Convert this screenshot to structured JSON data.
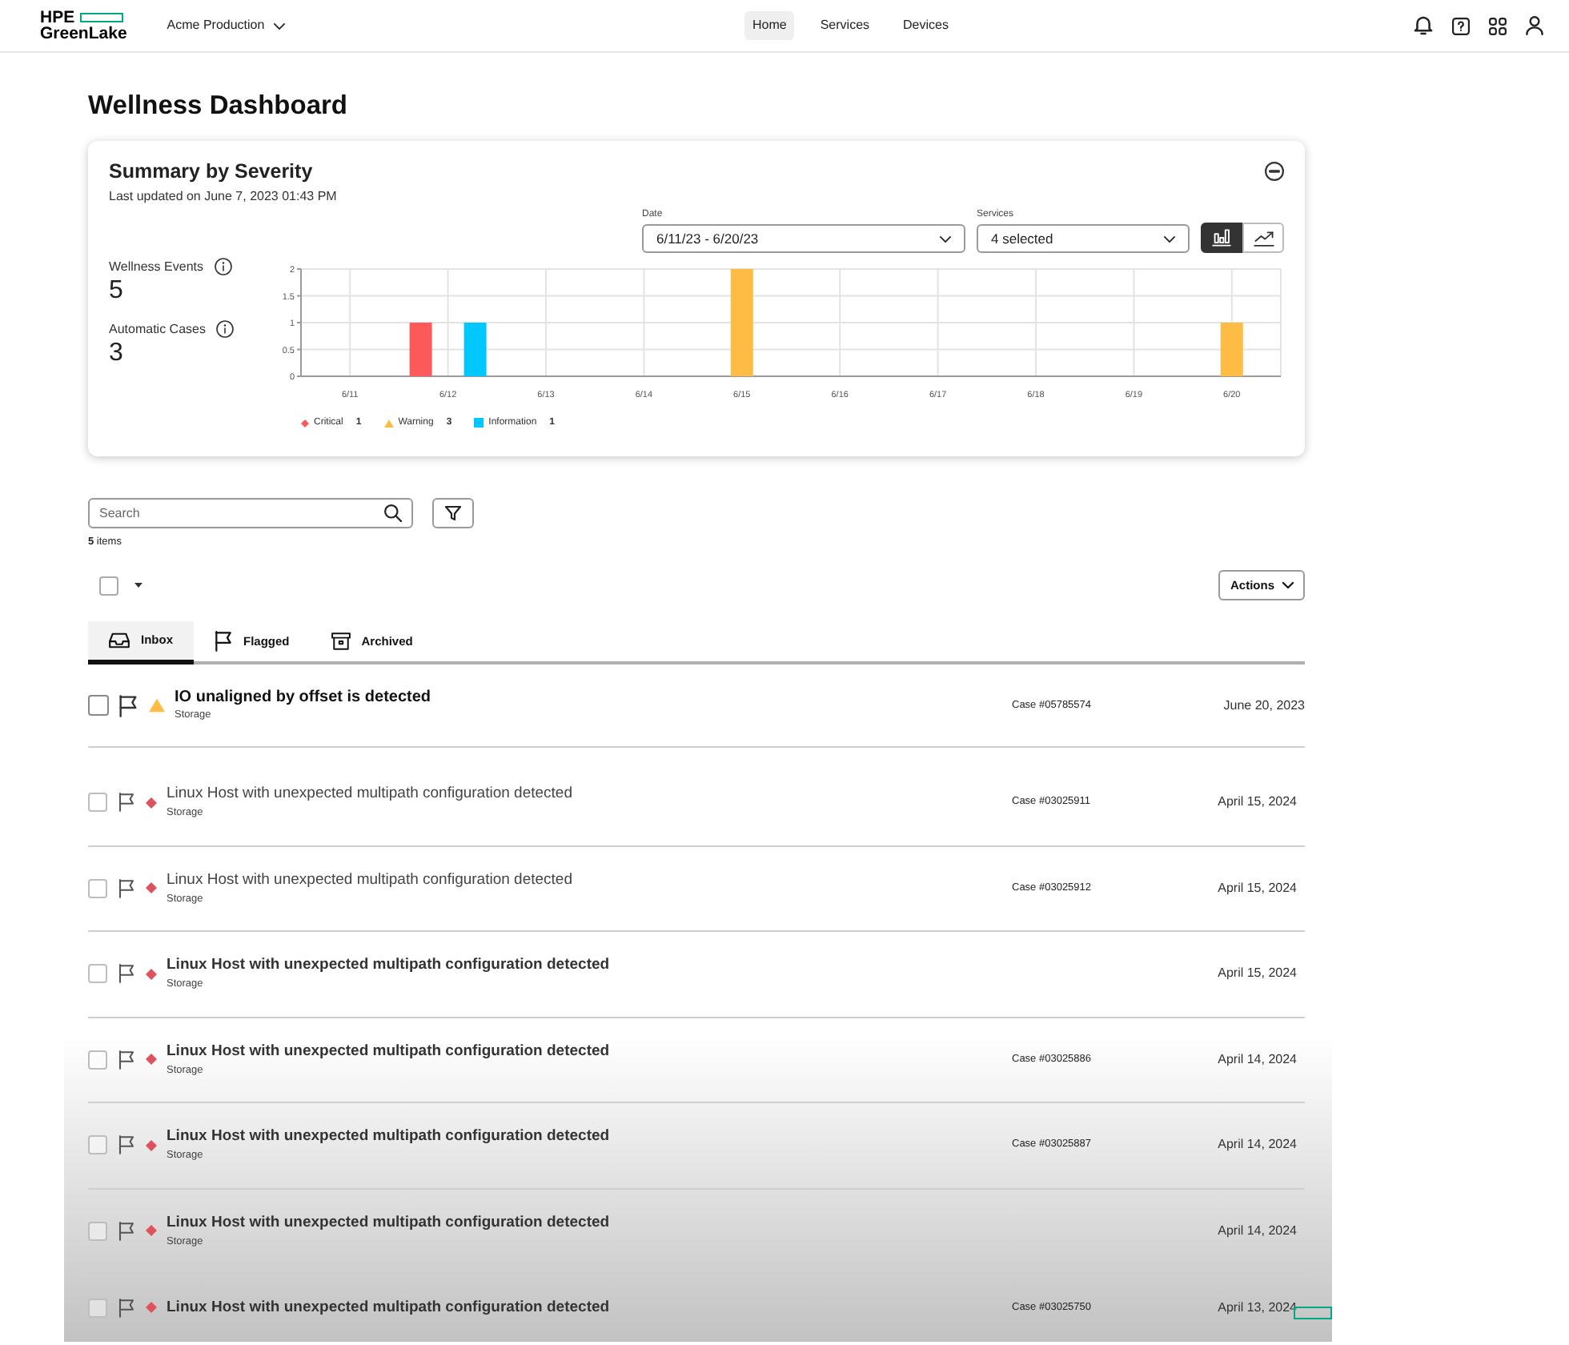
{
  "header": {
    "logo": {
      "line_1": "HPE",
      "line_2": "GreenLake"
    },
    "workspace": "Acme Production",
    "nav": [
      {
        "label": "Home",
        "selected": true
      },
      {
        "label": "Services",
        "selected": false
      },
      {
        "label": "Devices",
        "selected": false
      }
    ]
  },
  "page_title": "Wellness Dashboard",
  "summary": {
    "title": "Summary by Severity",
    "last_updated": "Last updated on June 7, 2023 01:43 PM",
    "date_filter": {
      "label": "Date",
      "value": "6/11/23 - 6/20/23"
    },
    "services_filter": {
      "label": "Services",
      "value": "4 selected"
    },
    "view_toggle": [
      {
        "kind": "bar",
        "selected": true
      },
      {
        "kind": "line",
        "selected": false
      }
    ],
    "stats": [
      {
        "label": "Wellness Events",
        "value": "5"
      },
      {
        "label": "Automatic Cases",
        "value": "3"
      }
    ],
    "chart_data": {
      "type": "bar",
      "grid": true,
      "categories": [
        "6/11",
        "6/12",
        "6/13",
        "6/14",
        "6/15",
        "6/16",
        "6/17",
        "6/18",
        "6/19",
        "6/20"
      ],
      "series": [
        {
          "name": "Critical",
          "color": "#fc5a5a",
          "values": [
            0,
            1,
            0,
            0,
            0,
            0,
            0,
            0,
            0,
            0
          ]
        },
        {
          "name": "Warning",
          "color": "#ffbc44",
          "values": [
            0,
            0,
            0,
            0,
            2,
            0,
            0,
            0,
            0,
            1
          ]
        },
        {
          "name": "Information",
          "color": "#00c8ff",
          "values": [
            0,
            1,
            0,
            0,
            0,
            0,
            0,
            0,
            0,
            0
          ]
        }
      ],
      "ylim": [
        0,
        2
      ],
      "yticks": [
        0,
        0.5,
        1,
        1.5,
        2
      ]
    },
    "legend": [
      {
        "kind": "diamond",
        "count": "1"
      },
      {
        "kind": "triangle",
        "count": "3"
      },
      {
        "kind": "square",
        "count": "1"
      }
    ]
  },
  "search": {
    "placeholder": "Search"
  },
  "item_count": "**5** items",
  "select_all": {
    "checked": false
  },
  "actions_button": "Actions",
  "tabs": [
    {
      "kind": "inbox",
      "label": "Inbox",
      "selected": true
    },
    {
      "kind": "flag",
      "label": "Flagged",
      "selected": false
    },
    {
      "kind": "archive",
      "label": "Archived",
      "selected": false
    }
  ],
  "events": [
    {
      "title": "IO unaligned by offset is detected",
      "category": "Storage",
      "kind": "warning",
      "checked": false,
      "read": false,
      "focused": true,
      "case": "Case #05785574",
      "date": "June 20, 2023"
    },
    {
      "title": "Linux Host with unexpected multipath configuration detected",
      "category": "Storage",
      "kind": "critical",
      "checked": false,
      "read": true,
      "focused": false,
      "case": "Case #03025911",
      "date": "April 15, 2024"
    },
    {
      "title": "Linux Host with unexpected multipath configuration detected",
      "category": "Storage",
      "kind": "critical",
      "checked": false,
      "read": true,
      "focused": false,
      "case": "Case #03025912",
      "date": "April 15, 2024"
    },
    {
      "title": "Linux Host with unexpected multipath configuration detected",
      "category": "Storage",
      "kind": "critical",
      "checked": false,
      "read": false,
      "focused": false,
      "date": "April 15, 2024"
    },
    {
      "title": "Linux Host with unexpected multipath configuration detected",
      "category": "Storage",
      "kind": "critical",
      "checked": false,
      "read": false,
      "focused": false,
      "case": "Case #03025886",
      "date": "April 14, 2024"
    },
    {
      "title": "Linux Host with unexpected multipath configuration detected",
      "category": "Storage",
      "kind": "critical",
      "checked": false,
      "read": false,
      "focused": false,
      "case": "Case #03025887",
      "date": "April 14, 2024"
    },
    {
      "title": "Linux Host with unexpected multipath configuration detected",
      "category": "Storage",
      "kind": "critical",
      "checked": false,
      "read": false,
      "focused": false,
      "date": "April 14, 2024"
    },
    {
      "title": "Linux Host with unexpected multipath configuration detected",
      "kind": "critical",
      "checked": false,
      "read": false,
      "focused": false,
      "case": "Case #03025750",
      "date": "April 13, 2024"
    }
  ]
}
